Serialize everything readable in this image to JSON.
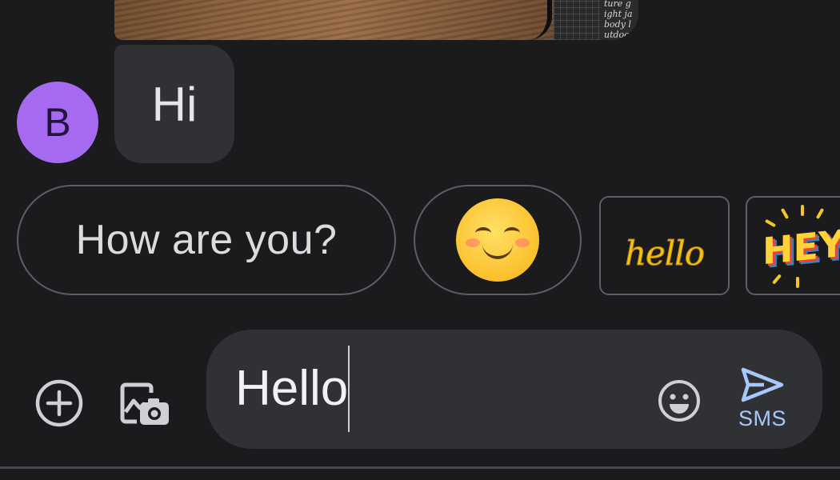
{
  "conversation": {
    "image_message": {
      "package_text": "mpe\nhis ea\nture g\night ja\nbody l\nutdoor"
    },
    "avatar": {
      "initial": "B",
      "color": "#a56af0"
    },
    "incoming_message": {
      "text": "Hi"
    }
  },
  "smart_replies": {
    "text_chip": "How are you?",
    "emoji_chip": {
      "icon": "smiling-face-emoji"
    },
    "stickers": [
      {
        "name": "hello-sticker",
        "text": "hello"
      },
      {
        "name": "hey-sticker",
        "text": "HEY"
      }
    ]
  },
  "compose": {
    "attach_icon": "add-circle-icon",
    "gallery_icon": "gallery-camera-icon",
    "input_value": "Hello",
    "emoji_icon": "emoji-face-icon",
    "send_icon": "send-icon",
    "send_label": "SMS"
  },
  "colors": {
    "background": "#1b1b1d",
    "bubble": "#303134",
    "send_accent": "#a8c7fa",
    "avatar": "#a56af0"
  }
}
